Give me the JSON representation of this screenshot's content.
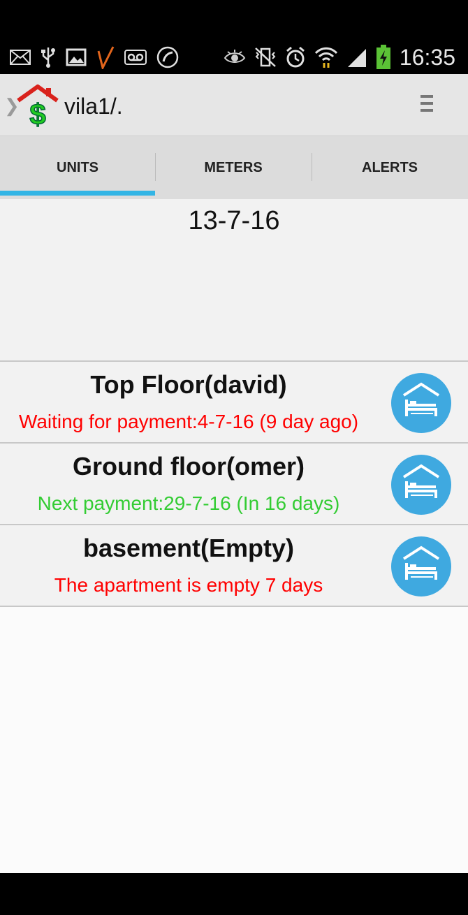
{
  "status_bar": {
    "time": "16:35",
    "icons": [
      "mail-icon",
      "usb-icon",
      "image-icon",
      "app-v-icon",
      "voicemail-icon",
      "call-icon",
      "eye-icon",
      "no-vibrate-icon",
      "alarm-icon",
      "wifi-icon",
      "signal-icon",
      "battery-charging-icon"
    ]
  },
  "action_bar": {
    "title": "vila1/.",
    "logo": "house-dollar-logo",
    "menu_icon": "overflow-menu-icon"
  },
  "tabs": [
    {
      "label": "UNITS",
      "selected": true
    },
    {
      "label": "METERS",
      "selected": false
    },
    {
      "label": "ALERTS",
      "selected": false
    }
  ],
  "date": "13-7-16",
  "units": [
    {
      "name": "Top Floor(david)",
      "status": "Waiting for payment:4-7-16 (9 day ago)",
      "status_color": "#ff0000"
    },
    {
      "name": "Ground floor(omer)",
      "status": "Next payment:29-7-16 (In 16 days)",
      "status_color": "#33cc33"
    },
    {
      "name": "basement(Empty)",
      "status": "The apartment is empty 7 days",
      "status_color": "#ff0000"
    }
  ],
  "colors": {
    "accent": "#33b5e5",
    "unit_icon_bg": "#3fa9e0"
  }
}
